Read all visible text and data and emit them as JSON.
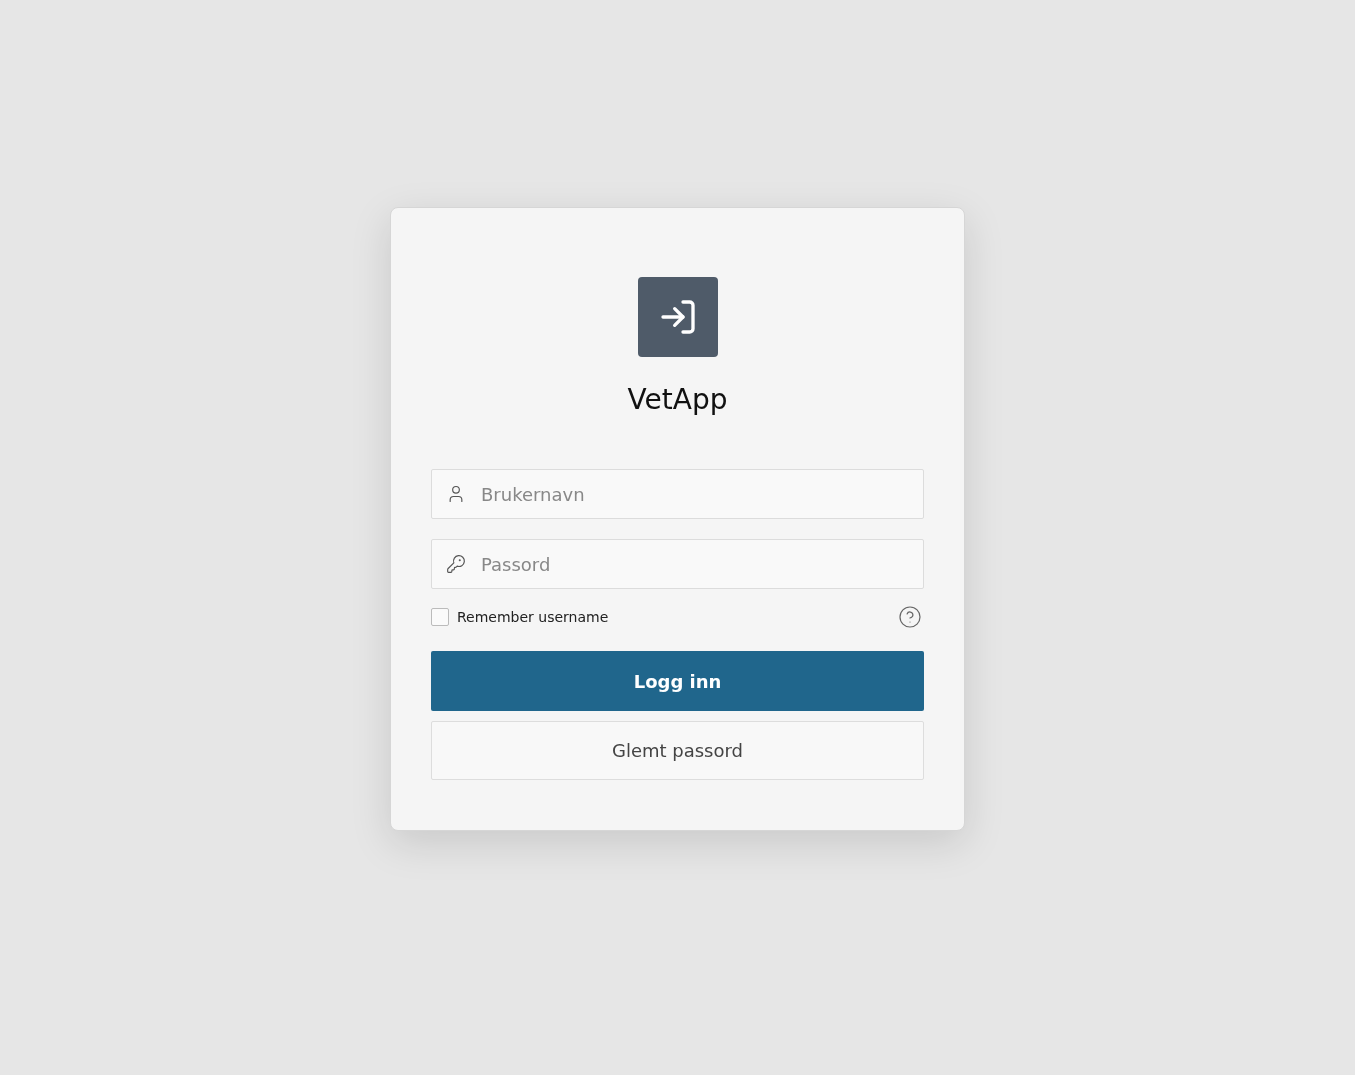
{
  "app": {
    "title": "VetApp"
  },
  "fields": [
    {
      "kind": "user",
      "placeholder": "Brukernavn"
    },
    {
      "kind": "key",
      "placeholder": "Passord"
    }
  ],
  "remember": {
    "label": "Remember username",
    "checked": false
  },
  "buttons": [
    {
      "kind": "primary",
      "label": "Logg inn"
    },
    {
      "kind": "secondary",
      "label": "Glemt passord"
    }
  ]
}
